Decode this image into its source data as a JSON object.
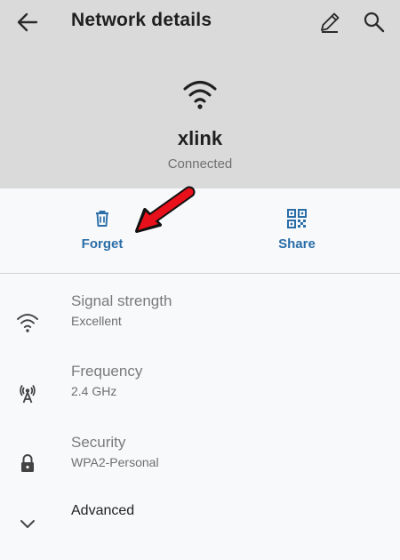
{
  "appbar": {
    "title": "Network details"
  },
  "icons": {
    "back": "arrow-back-icon",
    "edit": "pencil-icon",
    "search": "search-icon",
    "wifi": "wifi-icon",
    "trash": "trash-icon",
    "qr": "qr-code-icon",
    "antenna": "antenna-icon",
    "lock": "lock-icon",
    "chevron": "chevron-down-icon",
    "annotation": "red-arrow"
  },
  "network": {
    "ssid": "xlink",
    "status": "Connected"
  },
  "actions": {
    "forget": "Forget",
    "share": "Share"
  },
  "details": [
    {
      "title": "Signal strength",
      "value": "Excellent"
    },
    {
      "title": "Frequency",
      "value": "2.4 GHz"
    },
    {
      "title": "Security",
      "value": "WPA2-Personal"
    }
  ],
  "advanced": {
    "title": "Advanced"
  },
  "colors": {
    "accent": "#2a6ea8",
    "header_bg": "#dadada",
    "annotation": "#e8101a"
  }
}
